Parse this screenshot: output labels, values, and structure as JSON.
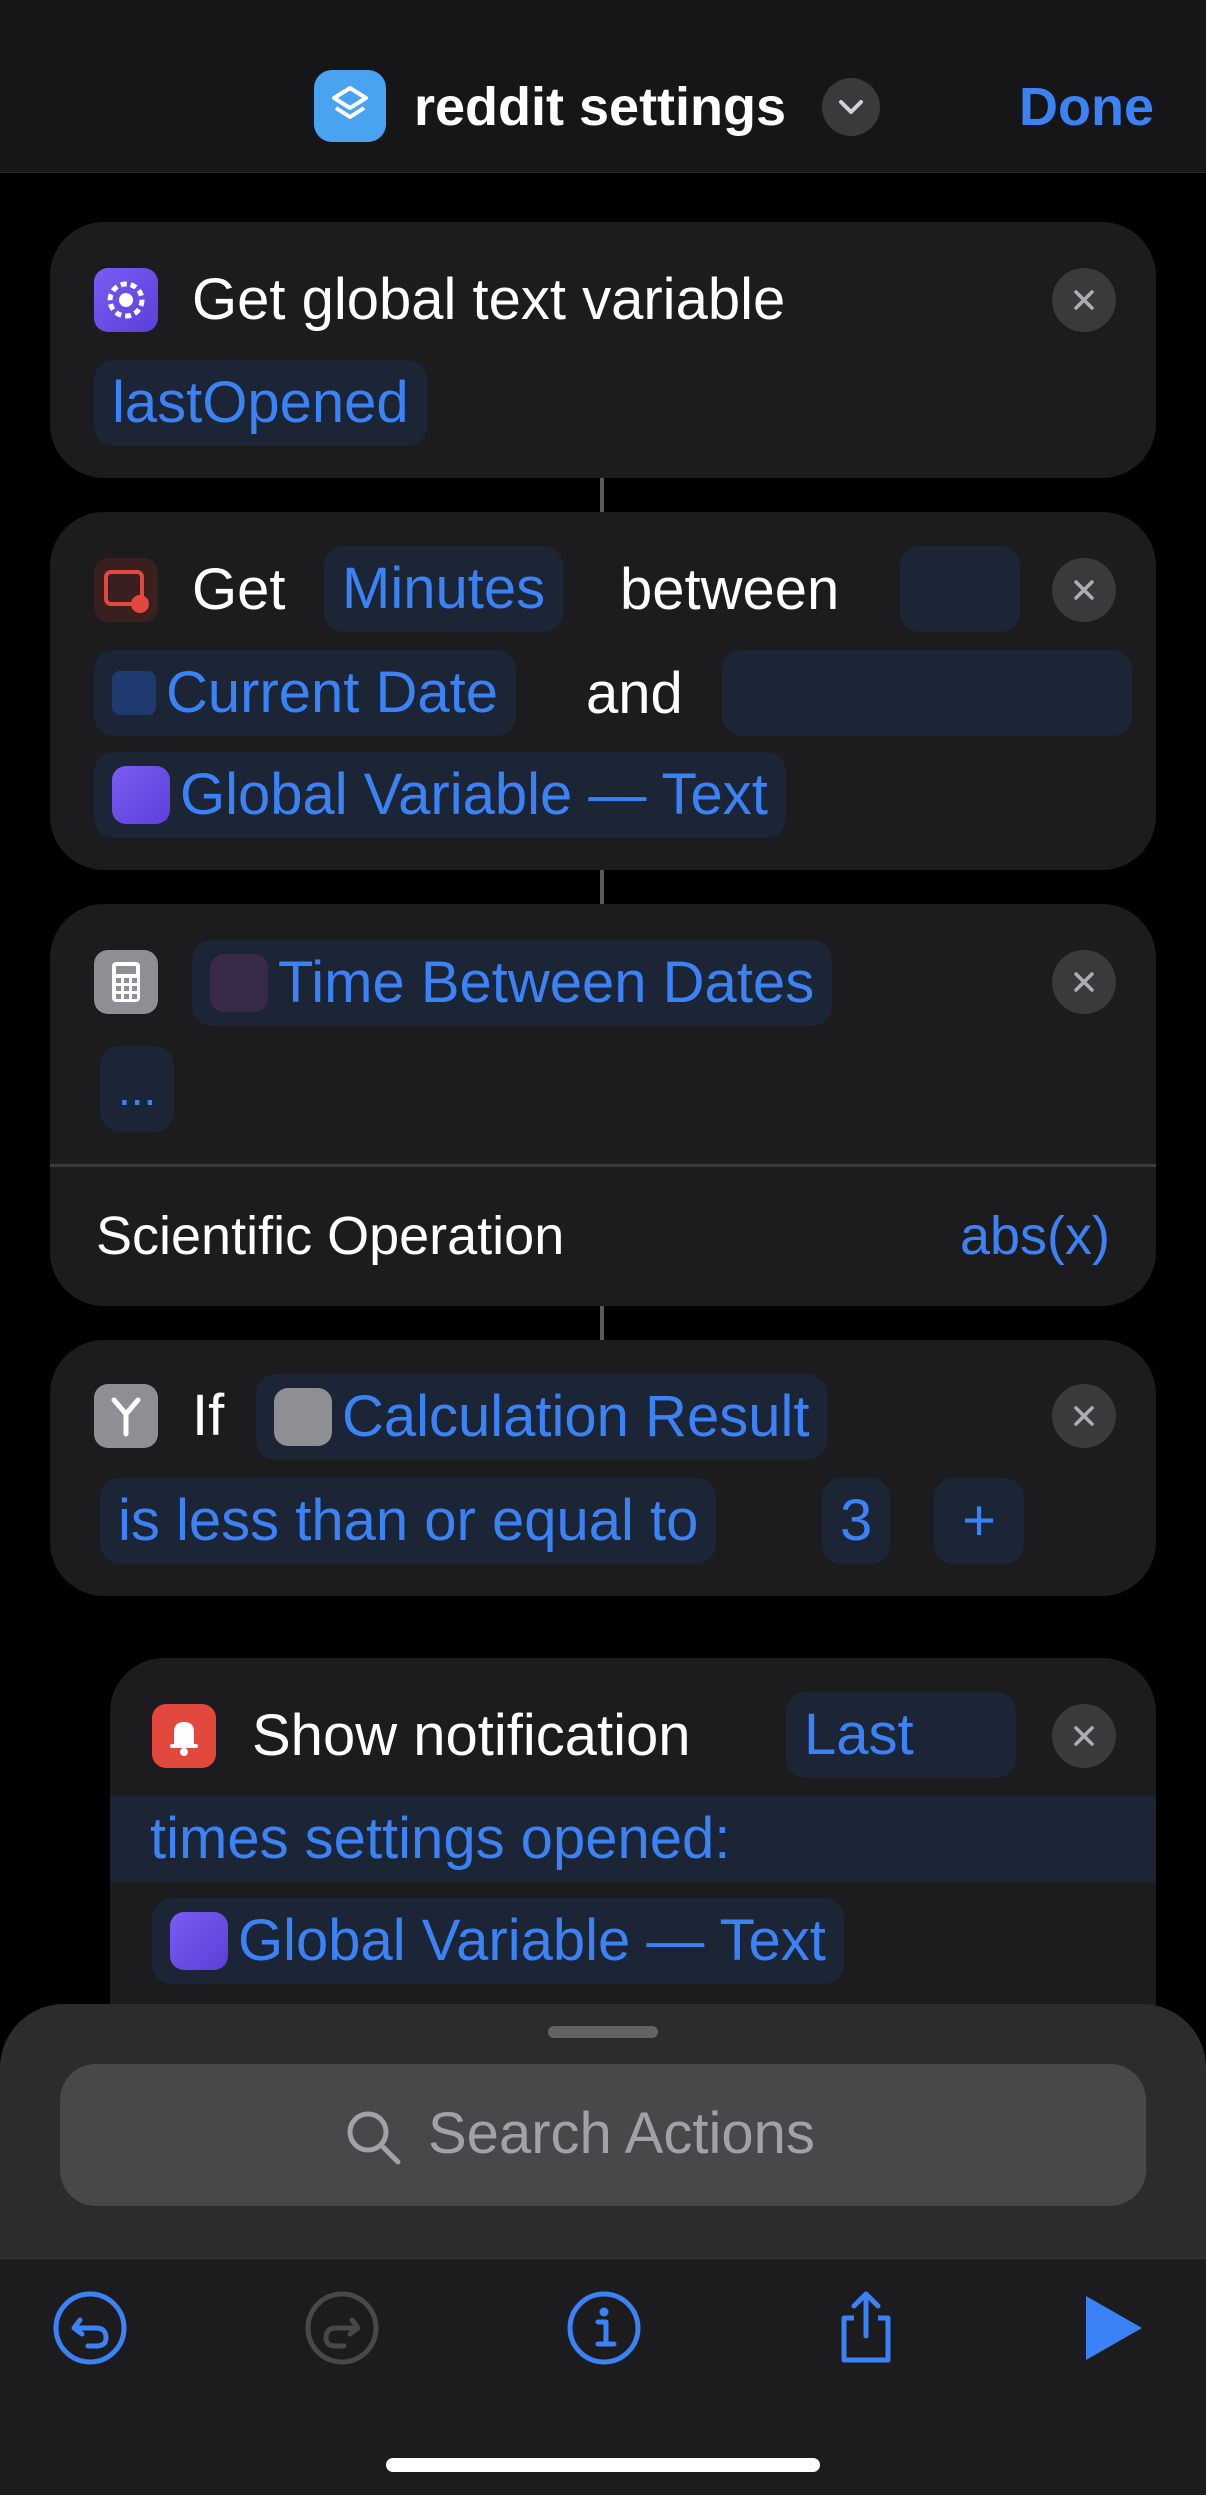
{
  "nav": {
    "title": "reddit settings",
    "done_label": "Done"
  },
  "actions": {
    "get_global": {
      "label": "Get global text variable",
      "variable": "lastOpened"
    },
    "get_time_between": {
      "get_word": "Get",
      "unit": "Minutes",
      "between_word": "between",
      "start": "Current Date",
      "and_word": "and",
      "end": "Global Variable — Text"
    },
    "calculate": {
      "input": "Time Between Dates",
      "more": "...",
      "option_label": "Scientific Operation",
      "option_value": "abs(x)"
    },
    "if": {
      "if_word": "If",
      "input": "Calculation Result",
      "condition": "is less than or equal to",
      "value": "3",
      "add": "+"
    },
    "notification": {
      "label": "Show notification",
      "text_part1": "Last",
      "text_part2": "times settings opened:",
      "variable": "Global Variable — Text"
    }
  },
  "search": {
    "placeholder": "Search Actions"
  },
  "colors": {
    "accent": "#3b82f6",
    "background": "#000000",
    "card": "#1c1c1e"
  },
  "icons": [
    "app-icon",
    "chevron-down-icon",
    "gear-icon",
    "calendar-clock-icon",
    "calendar-icon",
    "calculator-icon",
    "branch-icon",
    "bell-icon",
    "close-icon",
    "search-icon",
    "undo-icon",
    "redo-icon",
    "info-icon",
    "share-icon",
    "play-icon"
  ]
}
